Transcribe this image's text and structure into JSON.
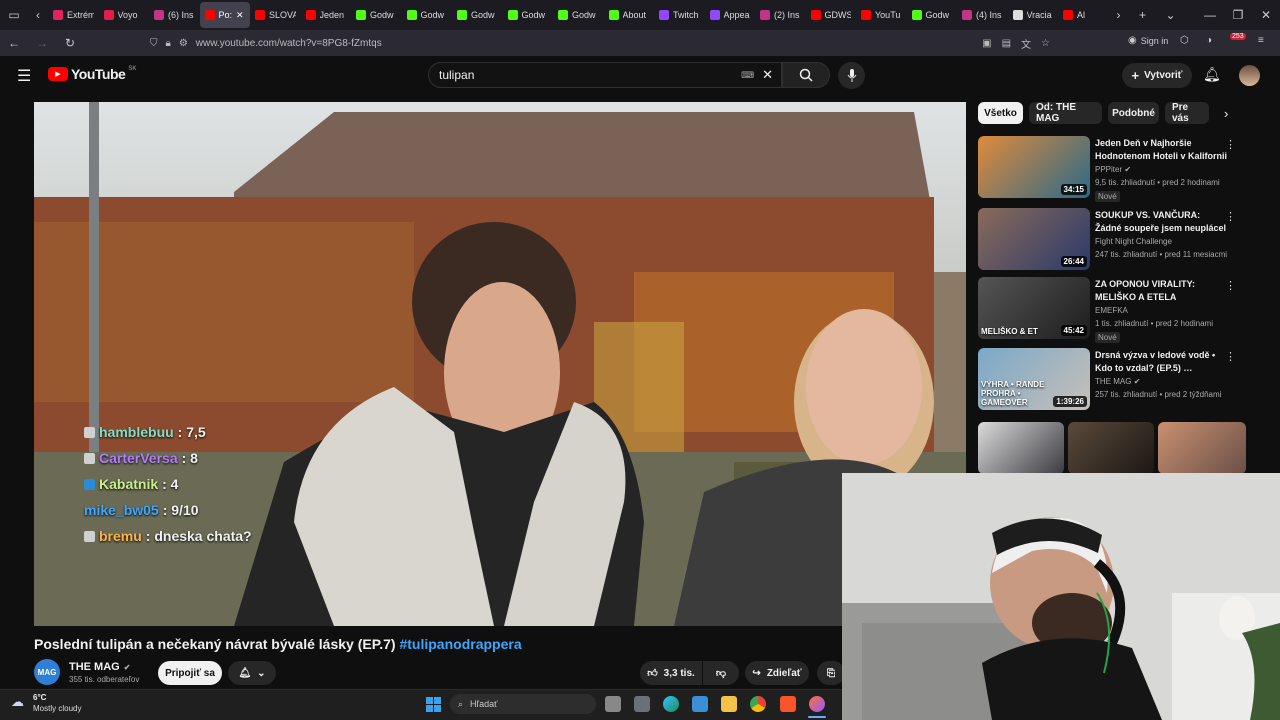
{
  "browser": {
    "tabs": [
      {
        "label": "Extrém",
        "color": "#e0245e"
      },
      {
        "label": "Voyo",
        "color": "#e11d48"
      },
      {
        "label": "(6) Ins",
        "color": "#c13584"
      },
      {
        "label": "Po:",
        "color": "#ff0000"
      },
      {
        "label": "SLOVA",
        "color": "#ff0000"
      },
      {
        "label": "Jeden",
        "color": "#ff0000"
      },
      {
        "label": "Godw",
        "color": "#53fc18"
      },
      {
        "label": "Godw",
        "color": "#53fc18"
      },
      {
        "label": "Godw",
        "color": "#53fc18"
      },
      {
        "label": "Godw",
        "color": "#53fc18"
      },
      {
        "label": "Godw",
        "color": "#53fc18"
      },
      {
        "label": "About",
        "color": "#53fc18"
      },
      {
        "label": "Twitch",
        "color": "#9146ff"
      },
      {
        "label": "Appea",
        "color": "#9146ff"
      },
      {
        "label": "(2) Ins",
        "color": "#c13584"
      },
      {
        "label": "GDWS",
        "color": "#ff0000"
      },
      {
        "label": "YouTu",
        "color": "#ff0000"
      },
      {
        "label": "Godw",
        "color": "#53fc18"
      },
      {
        "label": "(4) Ins",
        "color": "#c13584"
      },
      {
        "label": "Vracia",
        "color": "#dddddd"
      },
      {
        "label": "Al",
        "color": "#ff0000"
      }
    ],
    "url": "www.youtube.com/watch?v=8PG8-fZmtqs",
    "sign_in": "Sign in",
    "badge_count": "253"
  },
  "youtube": {
    "logo": "YouTube",
    "region": "SK",
    "search_value": "tulipan",
    "create_label": "Vytvoriť"
  },
  "chat": [
    {
      "name": "hamblebuu",
      "text": ": 7,5",
      "color": "#7fe0c8"
    },
    {
      "name": "CarterVersa",
      "text": ": 8",
      "color": "#b57cff"
    },
    {
      "name": "Kabatnik",
      "text": ": 4",
      "color": "#c8f08a"
    },
    {
      "name": "mike_bw05",
      "text": ": 9/10",
      "color": "#3ea6ff"
    },
    {
      "name": "bremu",
      "text": ": dneska chata?",
      "color": "#ffb347"
    }
  ],
  "video": {
    "title": "Poslední tulipán a nečekaný návrat bývalé lásky (EP.7)",
    "hashtag": "#tulipanodrappera",
    "channel": "THE MAG",
    "subscribers": "355 tis. odberateľov",
    "avatar_text": "MAG",
    "join_label": "Pripojiť sa",
    "likes": "3,3 tis.",
    "share_label": "Zdieľať"
  },
  "sidebar": {
    "chips": [
      "Všetko",
      "Od: THE MAG",
      "Podobné",
      "Pre vás"
    ],
    "recommendations": [
      {
        "title": "Jeden Deň v Najhoršie Hodnotenom Hoteli v Kalifornii",
        "channel": "PPPiter",
        "meta": "9,5 tis. zhliadnutí • pred 2 hodinami",
        "duration": "34:15",
        "badge": "Nové",
        "verified": true
      },
      {
        "title": "SOUKUP VS. VANČURA: Žádné soupeře jsem neuplácel …",
        "channel": "Fight Night Challenge",
        "meta": "247 tis. zhliadnutí • pred 11 mesiacmi",
        "duration": "26:44",
        "badge": "",
        "verified": false
      },
      {
        "title": "ZA OPONOU VIRALITY: MELIŠKO A ETELA",
        "channel": "EMEFKA",
        "meta": "1 tis. zhliadnutí • pred 2 hodinami",
        "duration": "45:42",
        "badge": "Nové",
        "verified": false,
        "thumb_text": "MELIŠKO & ET"
      },
      {
        "title": "Drsná výzva v ledové vodě • Kdo to vzdal? (EP.5) …",
        "channel": "THE MAG",
        "meta": "257 tis. zhliadnutí • pred 2 týždňami",
        "duration": "1:39:26",
        "badge": "",
        "verified": true,
        "thumb_text": "VÝHRA • RANDE PROHRA • GAMEOVER"
      }
    ]
  },
  "taskbar": {
    "temp": "6°C",
    "weather": "Mostly cloudy",
    "search_placeholder": "Hľadať"
  }
}
